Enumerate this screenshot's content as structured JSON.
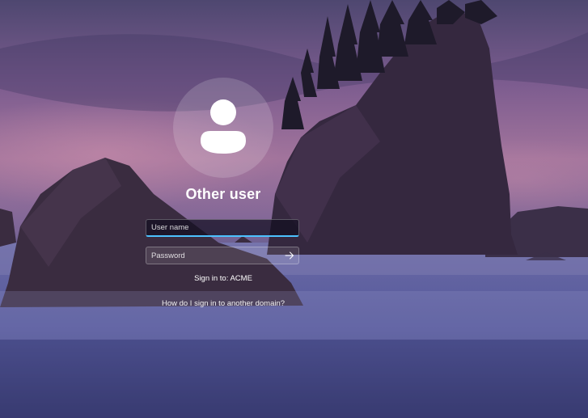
{
  "user": {
    "display_name": "Other user"
  },
  "form": {
    "username_placeholder": "User name",
    "username_value": "",
    "password_placeholder": "Password",
    "password_value": "",
    "submit_icon": "arrow-right-icon"
  },
  "sign_in_to": "Sign in to: ACME",
  "domain_help_link": "How do I sign in to another domain?",
  "colors": {
    "focus_accent": "#4cc2ff",
    "text": "#ffffff"
  }
}
